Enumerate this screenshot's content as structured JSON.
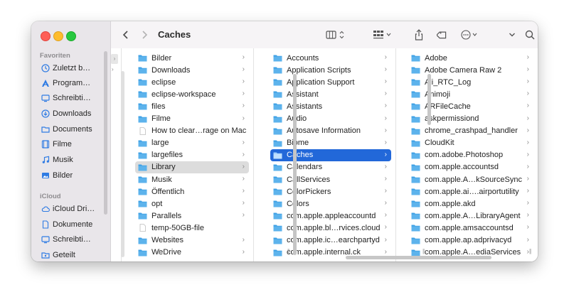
{
  "window": {
    "title": "Caches"
  },
  "sidebar": {
    "sections": [
      {
        "label": "Favoriten"
      },
      {
        "label": "iCloud"
      }
    ],
    "favorites": [
      {
        "label": "Zuletzt b…",
        "icon": "clock-icon"
      },
      {
        "label": "Program…",
        "icon": "apps-icon"
      },
      {
        "label": "Schreibti…",
        "icon": "desktop-icon"
      },
      {
        "label": "Downloads",
        "icon": "download-icon"
      },
      {
        "label": "Documents",
        "icon": "folder-icon"
      },
      {
        "label": "Filme",
        "icon": "film-icon"
      },
      {
        "label": "Musik",
        "icon": "music-icon"
      },
      {
        "label": "Bilder",
        "icon": "photo-icon"
      }
    ],
    "icloud": [
      {
        "label": "iCloud Dri…",
        "icon": "cloud-icon"
      },
      {
        "label": "Dokumente",
        "icon": "document-icon"
      },
      {
        "label": "Schreibti…",
        "icon": "desktop-icon"
      },
      {
        "label": "Geteilt",
        "icon": "shared-folder-icon"
      }
    ]
  },
  "columns": [
    {
      "items": [
        {
          "label": "Bilder",
          "type": "folder"
        },
        {
          "label": "Downloads",
          "type": "folder"
        },
        {
          "label": "eclipse",
          "type": "folder"
        },
        {
          "label": "eclipse-workspace",
          "type": "folder"
        },
        {
          "label": "files",
          "type": "folder"
        },
        {
          "label": "Filme",
          "type": "folder"
        },
        {
          "label": "How to clear…rage on Mac",
          "type": "file"
        },
        {
          "label": "large",
          "type": "folder"
        },
        {
          "label": "largefiles",
          "type": "folder"
        },
        {
          "label": "Library",
          "type": "folder",
          "selected": "grey"
        },
        {
          "label": "Musik",
          "type": "folder"
        },
        {
          "label": "Öffentlich",
          "type": "folder"
        },
        {
          "label": "opt",
          "type": "folder"
        },
        {
          "label": "Parallels",
          "type": "folder"
        },
        {
          "label": "temp-50GB-file",
          "type": "file"
        },
        {
          "label": "Websites",
          "type": "folder"
        },
        {
          "label": "WeDrive",
          "type": "folder"
        }
      ]
    },
    {
      "items": [
        {
          "label": "Accounts",
          "type": "folder"
        },
        {
          "label": "Application Scripts",
          "type": "folder"
        },
        {
          "label": "Application Support",
          "type": "folder"
        },
        {
          "label": "Assistant",
          "type": "folder"
        },
        {
          "label": "Assistants",
          "type": "folder"
        },
        {
          "label": "Audio",
          "type": "folder"
        },
        {
          "label": "Autosave Information",
          "type": "folder"
        },
        {
          "label": "Biome",
          "type": "folder"
        },
        {
          "label": "Caches",
          "type": "folder",
          "selected": "blue"
        },
        {
          "label": "Calendars",
          "type": "folder"
        },
        {
          "label": "CallServices",
          "type": "folder"
        },
        {
          "label": "ColorPickers",
          "type": "folder"
        },
        {
          "label": "Colors",
          "type": "folder"
        },
        {
          "label": "com.apple.appleaccountd",
          "type": "folder"
        },
        {
          "label": "com.apple.bl…rvices.cloud",
          "type": "folder"
        },
        {
          "label": "com.apple.ic…earchpartyd",
          "type": "folder"
        },
        {
          "label": "com.apple.internal.ck",
          "type": "folder"
        }
      ]
    },
    {
      "items": [
        {
          "label": "Adobe",
          "type": "folder"
        },
        {
          "label": "Adobe Camera Raw 2",
          "type": "folder"
        },
        {
          "label": "Ali_RTC_Log",
          "type": "folder"
        },
        {
          "label": "Animoji",
          "type": "folder"
        },
        {
          "label": "ARFileCache",
          "type": "folder"
        },
        {
          "label": "askpermissiond",
          "type": "folder"
        },
        {
          "label": "chrome_crashpad_handler",
          "type": "folder"
        },
        {
          "label": "CloudKit",
          "type": "folder"
        },
        {
          "label": "com.adobe.Photoshop",
          "type": "folder"
        },
        {
          "label": "com.apple.accountsd",
          "type": "folder"
        },
        {
          "label": "com.apple.A…kSourceSync",
          "type": "folder"
        },
        {
          "label": "com.apple.ai….airportutility",
          "type": "folder"
        },
        {
          "label": "com.apple.akd",
          "type": "folder"
        },
        {
          "label": "com.apple.A…LibraryAgent",
          "type": "folder"
        },
        {
          "label": "com.apple.amsaccountsd",
          "type": "folder"
        },
        {
          "label": "com.apple.ap.adprivacyd",
          "type": "folder"
        },
        {
          "label": "com.apple.A…ediaServices",
          "type": "folder"
        }
      ]
    }
  ],
  "colors": {
    "folder": "#3ea0e5",
    "selection": "#2268d9",
    "grey_selection": "#dcdcdc"
  }
}
